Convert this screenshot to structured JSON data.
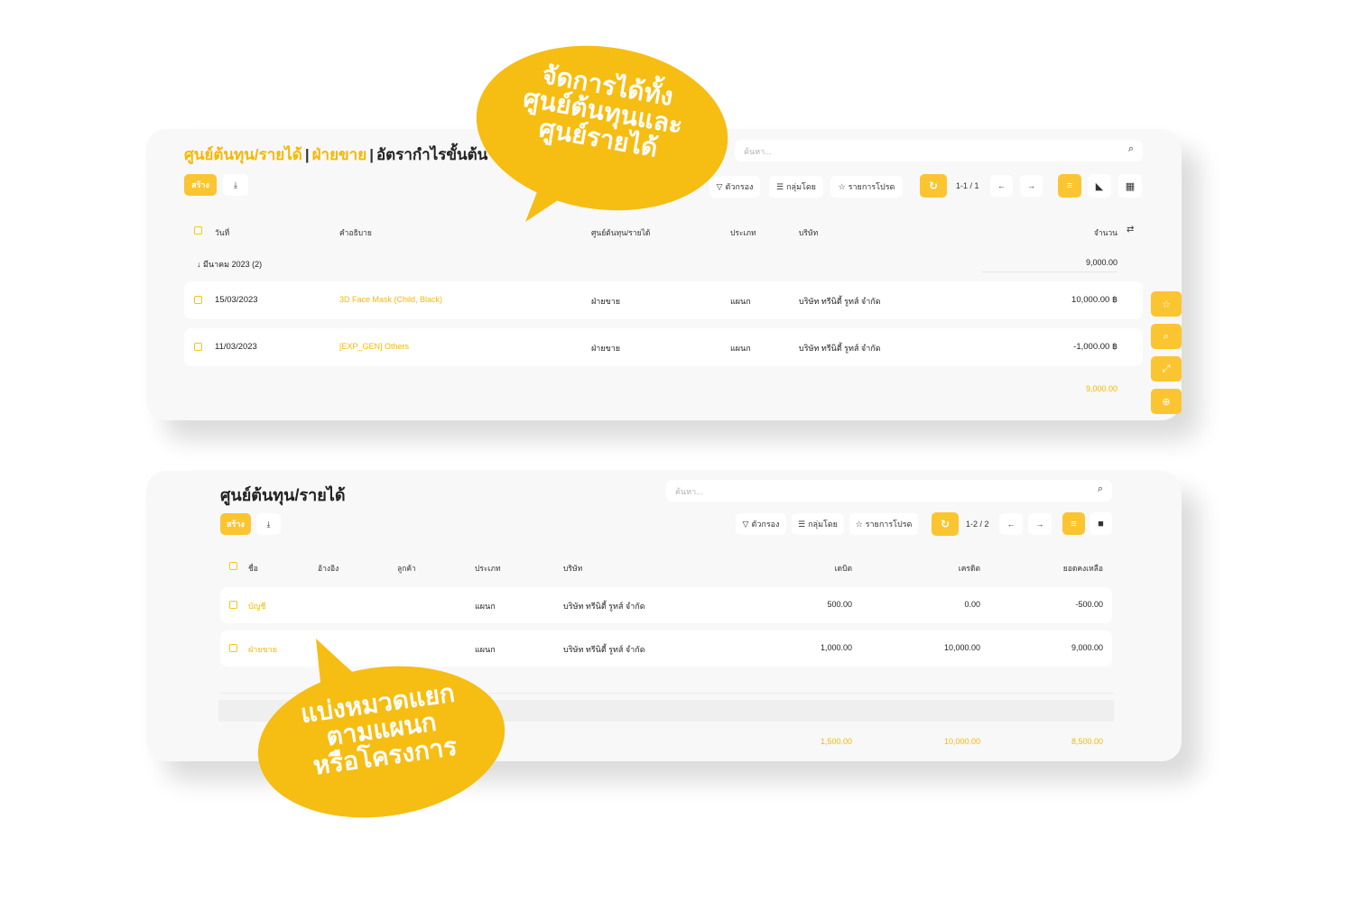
{
  "panel1": {
    "breadcrumb": [
      {
        "label": "ศูนย์ต้นทุน/รายได้"
      },
      {
        "label": "ฝ่ายขาย"
      },
      {
        "label": "อัตรากำไรขั้นต้น"
      }
    ],
    "search_placeholder": "ค้นหา...",
    "create_label": "สร้าง",
    "filter_label": "ตัวกรอง",
    "group_label": "กลุ่มโดย",
    "fav_label": "รายการโปรด",
    "pager": "1-1 / 1",
    "columns": {
      "date": "วันที่",
      "desc": "คำอธิบาย",
      "center": "ศูนย์ต้นทุน/รายได้",
      "type": "ประเภท",
      "company": "บริษัท",
      "amount": "จำนวน"
    },
    "group": {
      "label": "มีนาคม 2023 (2)",
      "total": "9,000.00"
    },
    "rows": [
      {
        "date": "15/03/2023",
        "desc": "3D Face Mask (Child, Black)",
        "center": "ฝ่ายขาย",
        "type": "แผนก",
        "company": "บริษัท ทรีนิตี้ รูทส์ จำกัด",
        "amount": "10,000.00 ฿"
      },
      {
        "date": "11/03/2023",
        "desc": "[EXP_GEN] Others",
        "center": "ฝ่ายขาย",
        "type": "แผนก",
        "company": "บริษัท ทรีนิตี้ รูทส์ จำกัด",
        "amount": "-1,000.00 ฿"
      }
    ],
    "footer_total": "9,000.00"
  },
  "panel2": {
    "title": "ศูนย์ต้นทุน/รายได้",
    "search_placeholder": "ค้นหา...",
    "create_label": "สร้าง",
    "filter_label": "ตัวกรอง",
    "group_label": "กลุ่มโดย",
    "fav_label": "รายการโปรด",
    "pager": "1-2 / 2",
    "columns": {
      "name": "ชื่อ",
      "ref": "อ้างอิง",
      "customer": "ลูกค้า",
      "type": "ประเภท",
      "company": "บริษัท",
      "debit": "เดบิต",
      "credit": "เครดิต",
      "balance": "ยอดคงเหลือ"
    },
    "rows": [
      {
        "name": "บัญชี",
        "type": "แผนก",
        "company": "บริษัท ทรีนิตี้ รูทส์ จำกัด",
        "debit": "500.00",
        "credit": "0.00",
        "balance": "-500.00"
      },
      {
        "name": "ฝ่ายขาย",
        "type": "แผนก",
        "company": "บริษัท ทรีนิตี้ รูทส์ จำกัด",
        "debit": "1,000.00",
        "credit": "10,000.00",
        "balance": "9,000.00"
      }
    ],
    "totals": {
      "debit": "1,500.00",
      "credit": "10,000.00",
      "balance": "8,500.00"
    }
  },
  "bubbles": {
    "top": "จัดการได้ทั้ง\nศูนย์ต้นทุนและ\nศูนย์รายได้",
    "bottom": "แบ่งหมวดแยก\nตามแผนก\nหรือโครงการ"
  },
  "colors": {
    "accent": "#fbc531",
    "panel_bg": "#f8f8f8"
  }
}
